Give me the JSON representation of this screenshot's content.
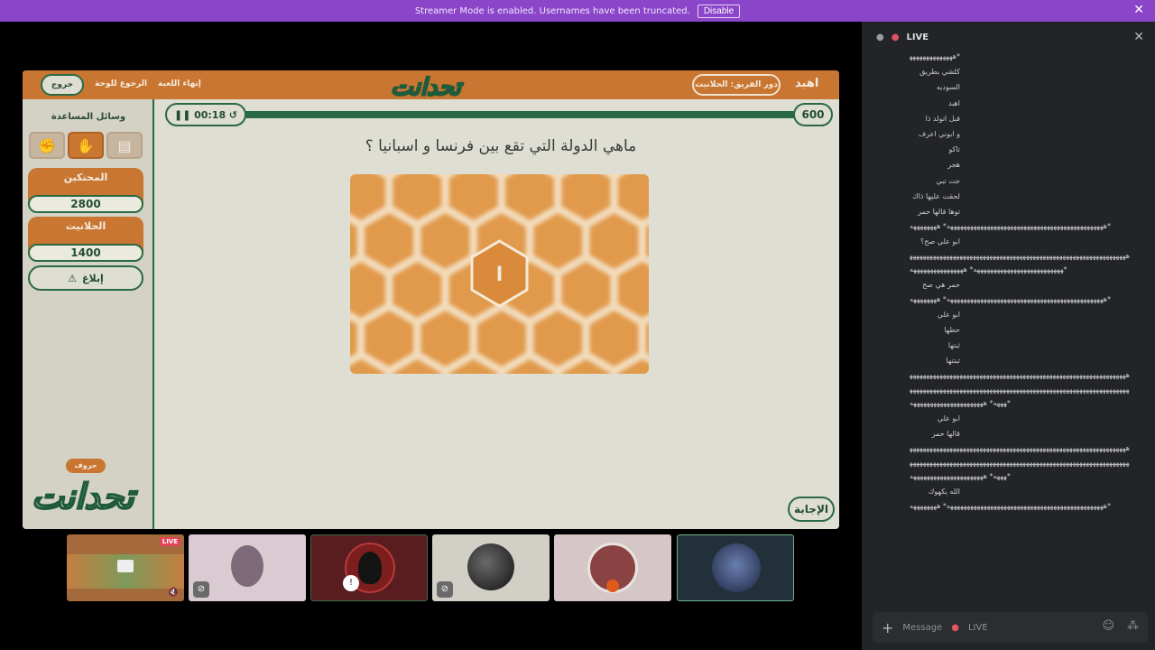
{
  "banner": {
    "text": "Streamer Mode is enabled. Usernames have been truncated.",
    "disable_label": "Disable"
  },
  "game": {
    "exit_label": "خروج",
    "back_label": "الرجوع للوحة",
    "end_label": "إنهاء اللعبة",
    "turn_label": "دور الفريق: الحلانيت",
    "player_label": "اهبد",
    "logo_text": "تحدانت",
    "aids_title": "وسائل المساعدة",
    "teams": [
      {
        "name": "المحتكين",
        "score": "2800"
      },
      {
        "name": "الحلانيت",
        "score": "1400"
      }
    ],
    "report_label": "إبلاغ",
    "letters_label": "حروف",
    "timer": "00:18",
    "points": "600",
    "question": "ماهي الدولة التي تقع بين فرنسا و اسبانيا ؟",
    "center_letter": "ا",
    "answer_label": "الإجابة"
  },
  "tiles": {
    "live_label": "LIVE"
  },
  "chat": {
    "header": "LIVE",
    "messages": [
      {
        "t": "*ههههههههههههههه",
        "long": false
      },
      {
        "t": "كلشي بطريق",
        "long": false
      },
      {
        "t": "السوديه",
        "long": false
      },
      {
        "t": "اهبد",
        "long": false
      },
      {
        "t": "قبل اتولد ذا",
        "long": false
      },
      {
        "t": "و ابوني اعرف",
        "long": false
      },
      {
        "t": "تاكو",
        "long": false
      },
      {
        "t": "هجر",
        "long": false
      },
      {
        "t": "جت تبي",
        "long": false
      },
      {
        "t": "لحقت عليها ذاك اليوم",
        "long": false
      },
      {
        "t": "توها قالها حمر",
        "long": false
      },
      {
        "t": "هههههههههههههههههههههههههههههههههههههههههههههههه* ههههههههه*",
        "long": true
      },
      {
        "t": "ابو علي صح؟",
        "long": false
      },
      {
        "t": "ههههههههههههههههههههههههههههههههههههههههههههههههههههههههههههههههههههههههههههههههههههههههههههه* ههههههههههههههههه*",
        "long": true
      },
      {
        "t": "حمر هي صح",
        "long": false
      },
      {
        "t": "هههههههههههههههههههههههههههههههههههههههههههههههه* ههههههههه*",
        "long": true
      },
      {
        "t": "ابو علي",
        "long": false
      },
      {
        "t": "حطها",
        "long": false
      },
      {
        "t": "ثبتها",
        "long": false
      },
      {
        "t": "ثبتتها",
        "long": false
      },
      {
        "t": "هههههههههههههههههههههههههههههههههههههههههههههههههههههههههههههههههههههههههههههههههههههههههههههههههههههههههههههههههههههههههههههههههههههههه* ههههههههههههههههههههههه*",
        "long": true
      },
      {
        "t": "ابو علي",
        "long": false
      },
      {
        "t": "قالها حمر",
        "long": false
      },
      {
        "t": "هههههههههههههههههههههههههههههههههههههههههههههههههههههههههههههههههههههههههههههههههههههههههههههههههههههههههههههههههههههههههههههههههههههههه* ههههههههههههههههههههههه*",
        "long": true
      },
      {
        "t": "الله يكهوك",
        "long": false
      },
      {
        "t": "هههههههههههههههههههههههههههههههههههههههههههههههه* ههههههههه*",
        "long": true
      }
    ],
    "input_placeholder": "Message",
    "input_live": "LIVE"
  }
}
